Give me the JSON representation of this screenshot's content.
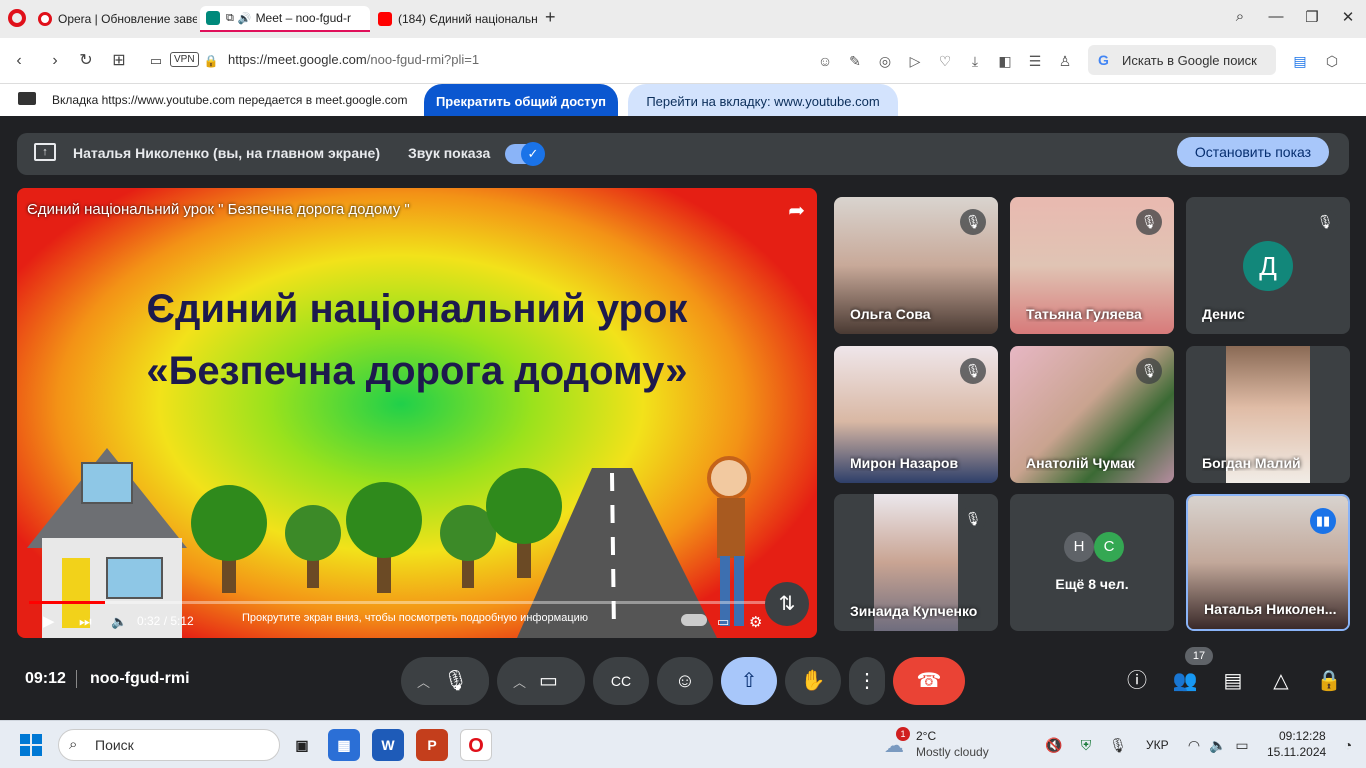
{
  "browser": {
    "tabs": [
      {
        "label": "Opera | Обновление заве",
        "color": "#e0101a"
      },
      {
        "label": "Meet – noo-fgud-r",
        "color": "#00897b"
      },
      {
        "label": "(184) Єдиний національн",
        "color": "#ff0000"
      }
    ],
    "new_tab": "+",
    "url_host": "https://meet.google.com",
    "url_path": "/noo-fgud-rmi?pli=1",
    "vpn_label": "VPN",
    "search_placeholder": "Искать в Google поиск",
    "search_g": "G"
  },
  "share_banner": {
    "text": "Вкладка https://www.youtube.com передается в meet.google.com",
    "stop_label": "Прекратить общий доступ",
    "goto_label": "Перейти на вкладку: www.youtube.com"
  },
  "presentation": {
    "presenter": "Наталья Николенко (вы, на главном экране)",
    "sound_label": "Звук показа",
    "stop_label": "Остановить показ"
  },
  "video": {
    "title": "Єдиний національний урок \" Безпечна дорога додому \"",
    "headline_1": "Єдиний національний урок",
    "headline_2": "«Безпечна дорога додому»",
    "time": "0:32 / 5:12",
    "progress": 0.1,
    "hint": "Прокрутите экран вниз, чтобы посмотреть подробную информацию"
  },
  "participants": [
    {
      "name": "Ольга Сова",
      "muted": true
    },
    {
      "name": "Татьяна Гуляева",
      "muted": true
    },
    {
      "name": "Денис",
      "muted": true,
      "initial": "Д",
      "color": "#12877a"
    },
    {
      "name": "Мирон Назаров",
      "muted": true
    },
    {
      "name": "Анатолій Чумак",
      "muted": true
    },
    {
      "name": "Богдан Малий",
      "muted": false
    },
    {
      "name": "Зинаида Купченко",
      "muted": true
    },
    {
      "name": "Ещё 8 чел.",
      "avatars": [
        "Н",
        "С"
      ]
    },
    {
      "name": "Наталья Николен...",
      "speaking": true
    }
  ],
  "meeting": {
    "time": "09:12",
    "code": "noo-fgud-rmi",
    "people_count": "17"
  },
  "taskbar": {
    "search_label": "Поиск",
    "weather_temp": "2°C",
    "weather_desc": "Mostly cloudy",
    "weather_badge": "1",
    "lang": "УКР",
    "time": "09:12:28",
    "date": "15.11.2024"
  }
}
